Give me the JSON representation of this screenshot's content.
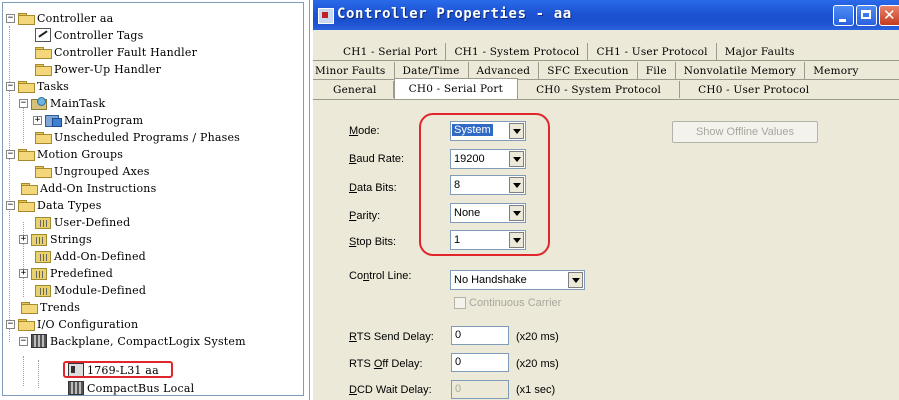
{
  "tree": {
    "items": [
      {
        "label": "Controller aa",
        "expander": "−",
        "icon": "folder-icon"
      },
      {
        "label": "Controller Tags",
        "icon": "controller-tags-icon"
      },
      {
        "label": "Controller Fault Handler",
        "icon": "folder-icon"
      },
      {
        "label": "Power-Up Handler",
        "icon": "folder-icon"
      },
      {
        "label": "Tasks",
        "expander": "−",
        "icon": "folder-icon"
      },
      {
        "label": "MainTask",
        "expander": "−",
        "icon": "task-icon"
      },
      {
        "label": "MainProgram",
        "expander": "+",
        "icon": "program-icon"
      },
      {
        "label": "Unscheduled Programs / Phases",
        "icon": "folder-icon"
      },
      {
        "label": "Motion Groups",
        "expander": "−",
        "icon": "folder-icon"
      },
      {
        "label": "Ungrouped Axes",
        "icon": "folder-icon"
      },
      {
        "label": "Add-On Instructions",
        "icon": "folder-icon"
      },
      {
        "label": "Data Types",
        "expander": "−",
        "icon": "folder-icon"
      },
      {
        "label": "User-Defined",
        "icon": "data-type-icon"
      },
      {
        "label": "Strings",
        "expander": "+",
        "icon": "data-type-icon"
      },
      {
        "label": "Add-On-Defined",
        "icon": "data-type-icon"
      },
      {
        "label": "Predefined",
        "expander": "+",
        "icon": "data-type-icon"
      },
      {
        "label": "Module-Defined",
        "icon": "data-type-icon"
      },
      {
        "label": "Trends",
        "icon": "folder-icon"
      },
      {
        "label": "I/O Configuration",
        "expander": "−",
        "icon": "folder-icon"
      },
      {
        "label": "Backplane, CompactLogix System",
        "expander": "−",
        "icon": "backplane-icon"
      },
      {
        "label": "1769-L31 aa",
        "icon": "controller-module-icon",
        "highlighted": true
      },
      {
        "label": "CompactBus Local",
        "icon": "backplane-icon"
      }
    ]
  },
  "dialog": {
    "title": "Controller Properties - aa",
    "tabs_row1": [
      "CH1 - Serial Port",
      "CH1 - System Protocol",
      "CH1 - User Protocol",
      "Major Faults"
    ],
    "tabs_row2": [
      "Minor Faults",
      "Date/Time",
      "Advanced",
      "SFC Execution",
      "File",
      "Nonvolatile Memory",
      "Memory"
    ],
    "tabs_row3": [
      "General",
      "CH0 - Serial Port",
      "CH0 - System Protocol",
      "CH0 - User Protocol"
    ],
    "active_tab": "CH0 - Serial Port",
    "fields": {
      "mode": {
        "label": "Mode:",
        "value": "System"
      },
      "baud_rate": {
        "label": "Baud Rate:",
        "value": "19200"
      },
      "data_bits": {
        "label": "Data Bits:",
        "value": "8"
      },
      "parity": {
        "label": "Parity:",
        "value": "None"
      },
      "stop_bits": {
        "label": "Stop Bits:",
        "value": "1"
      },
      "control_line": {
        "label": "Control Line:",
        "value": "No Handshake"
      },
      "continuous_carrier": {
        "label": "Continuous Carrier",
        "checked": false
      },
      "rts_send_delay": {
        "label": "RTS Send Delay:",
        "value": "0",
        "unit": "(x20 ms)"
      },
      "rts_off_delay": {
        "label": "RTS Off Delay:",
        "value": "0",
        "unit": "(x20 ms)"
      },
      "dcd_wait_delay": {
        "label": "DCD Wait Delay:",
        "value": "0",
        "unit": "(x1 sec)"
      }
    },
    "show_offline_values": "Show Offline Values"
  },
  "colors": {
    "highlight": "#e0262b",
    "titlebar": "#1d55d6",
    "dialog_bg": "#ece9d8"
  }
}
